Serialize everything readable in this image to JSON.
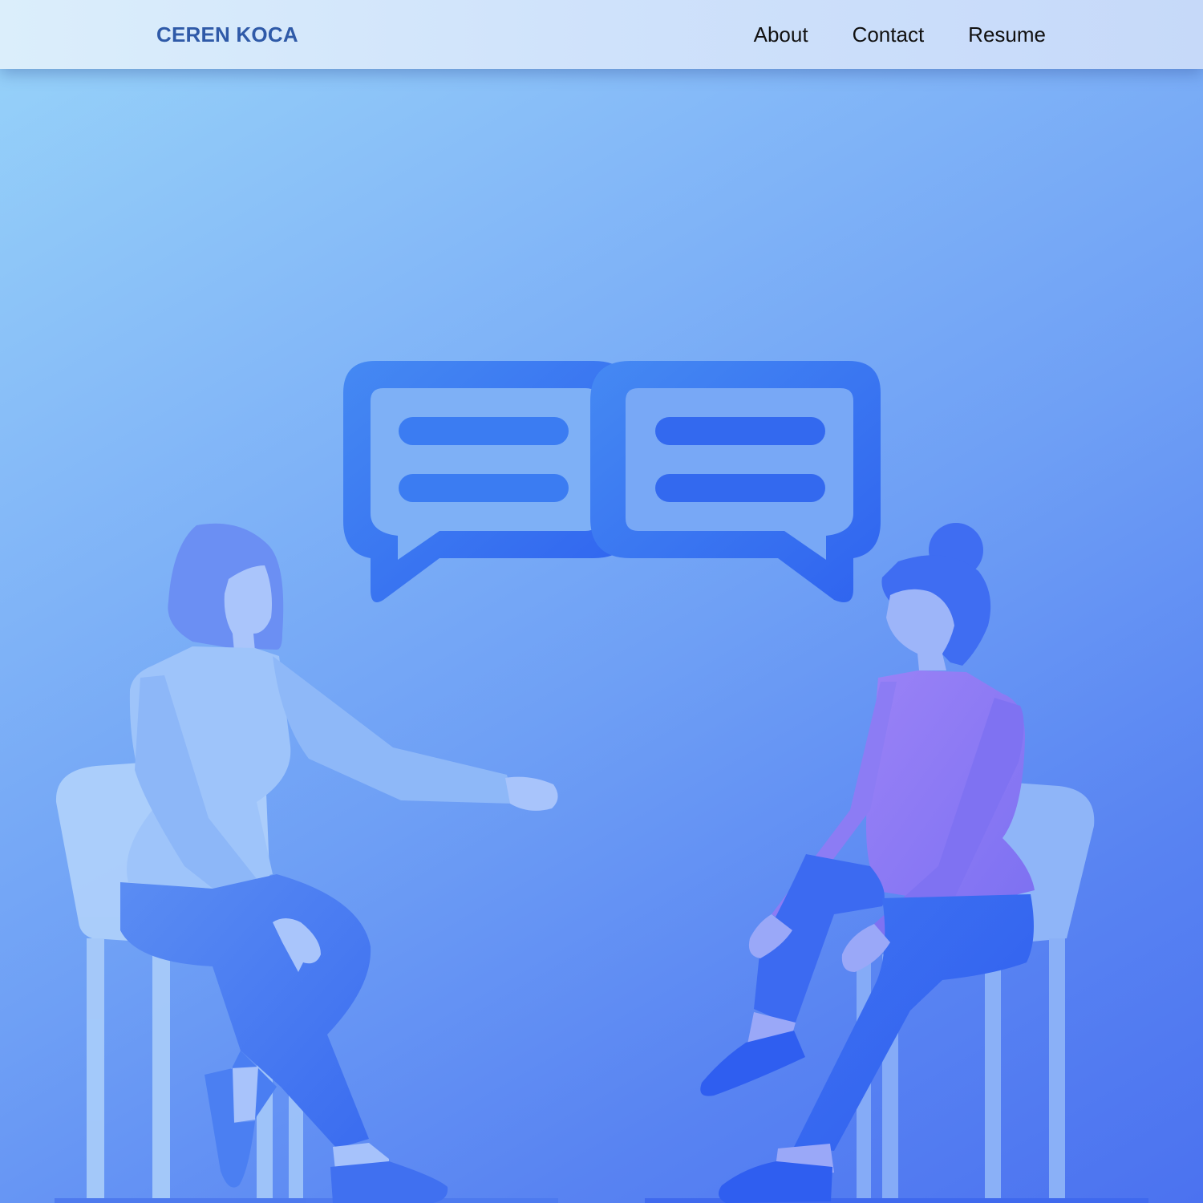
{
  "header": {
    "brand": "CEREN KOCA",
    "nav": [
      {
        "label": "About"
      },
      {
        "label": "Contact"
      },
      {
        "label": "Resume"
      }
    ]
  },
  "hero": {
    "illustration": "two-people-conversation",
    "icon": "speech-bubbles-icon"
  },
  "colors": {
    "header_bg": "#d6e8fb",
    "brand_text": "#2f5aa8",
    "nav_text": "#111111",
    "bg_gradient_start": "#98d4f9",
    "bg_gradient_end": "#4b72f0",
    "bubble": "#3a7cf2",
    "person_right_top": "#9480f5"
  }
}
